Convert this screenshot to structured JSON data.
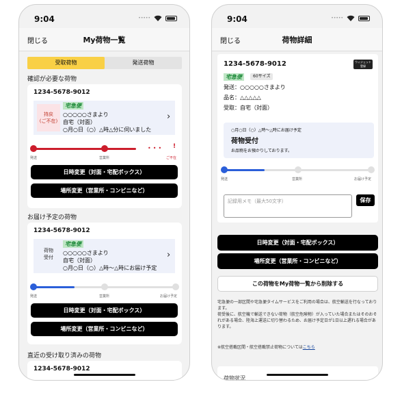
{
  "status_time": "9:04",
  "colors": {
    "accent_yellow": "#f9d046",
    "progress_red": "#cc1d2c",
    "progress_blue": "#2b5fd9",
    "black_button": "#000000"
  },
  "left": {
    "nav": {
      "close": "閉じる",
      "title": "My荷物一覧"
    },
    "tabs": [
      {
        "label": "受取荷物",
        "active": true
      },
      {
        "label": "発送荷物",
        "active": false
      }
    ],
    "section_confirm": "確認が必要な荷物",
    "card1": {
      "tracking_number": "1234-5678-9012",
      "status": "持戻\n(ご不在)",
      "service_logo": "宅急便",
      "sender": "○○○○○さまより",
      "destination": "自宅（対面）",
      "time": "○月○日（○）△時△分に伺いました",
      "progress_labels": [
        "発送",
        "営業所",
        "ご不在"
      ],
      "buttons": [
        "日時変更（対面・宅配ボックス）",
        "場所変更（営業所・コンビニなど）"
      ]
    },
    "section_scheduled": "お届け予定の荷物",
    "card2": {
      "tracking_number": "1234-5678-9012",
      "status": "荷物\n受付",
      "service_logo": "宅急便",
      "sender": "○○○○○さまより",
      "destination": "自宅（対面）",
      "time": "○月○日（○）△時〜△時にお届け予定",
      "progress_labels": [
        "発送",
        "営業所",
        "お届け予定"
      ],
      "buttons": [
        "日時変更（対面・宅配ボックス）",
        "場所変更（営業所・コンビニなど）"
      ]
    },
    "section_recent": "直近の受け取り済みの荷物",
    "card3": {
      "tracking_number": "1234-5678-9012"
    }
  },
  "right": {
    "nav": {
      "close": "閉じる",
      "title": "荷物詳細"
    },
    "tracking_number": "1234-5678-9012",
    "widget_label": "ウィジェット\n登録",
    "service_logo": "宅急便",
    "size": "60サイズ",
    "sender_line": "発送：○○○○○さまより",
    "item_line": "品名：△△△△△",
    "receive_line": "受取：自宅（対面）",
    "status_box": {
      "schedule": "○月○日（○）△時〜△時にお届け予定",
      "status": "荷物受付",
      "message": "お品物をお預かりしております。"
    },
    "progress_labels": [
      "発送",
      "営業所",
      "お届け予定"
    ],
    "memo_placeholder": "記録用メモ（最大50文字）",
    "save_label": "保存",
    "buttons": [
      "日時変更（対面・宅配ボックス）",
      "場所変更（営業所・コンビニなど）"
    ],
    "delete_button": "この荷物をMy荷物一覧から削除する",
    "notice": "宅急便の一部区間や宅急便タイムサービスをご利用の場合は、航空輸送を行なっております。\n荷受後に、航空機で輸送できない荷物（航空危険物）が入っていた場合またはそのおそれがある場合、陸海上運送に切り替わるため、お届け予定日が1日以上遅れる場合があります。",
    "footnote_text": "※航空搭載区間・航空搭載禁止荷物については",
    "footnote_link": "こちら",
    "cut_heading": "荷物状況"
  }
}
